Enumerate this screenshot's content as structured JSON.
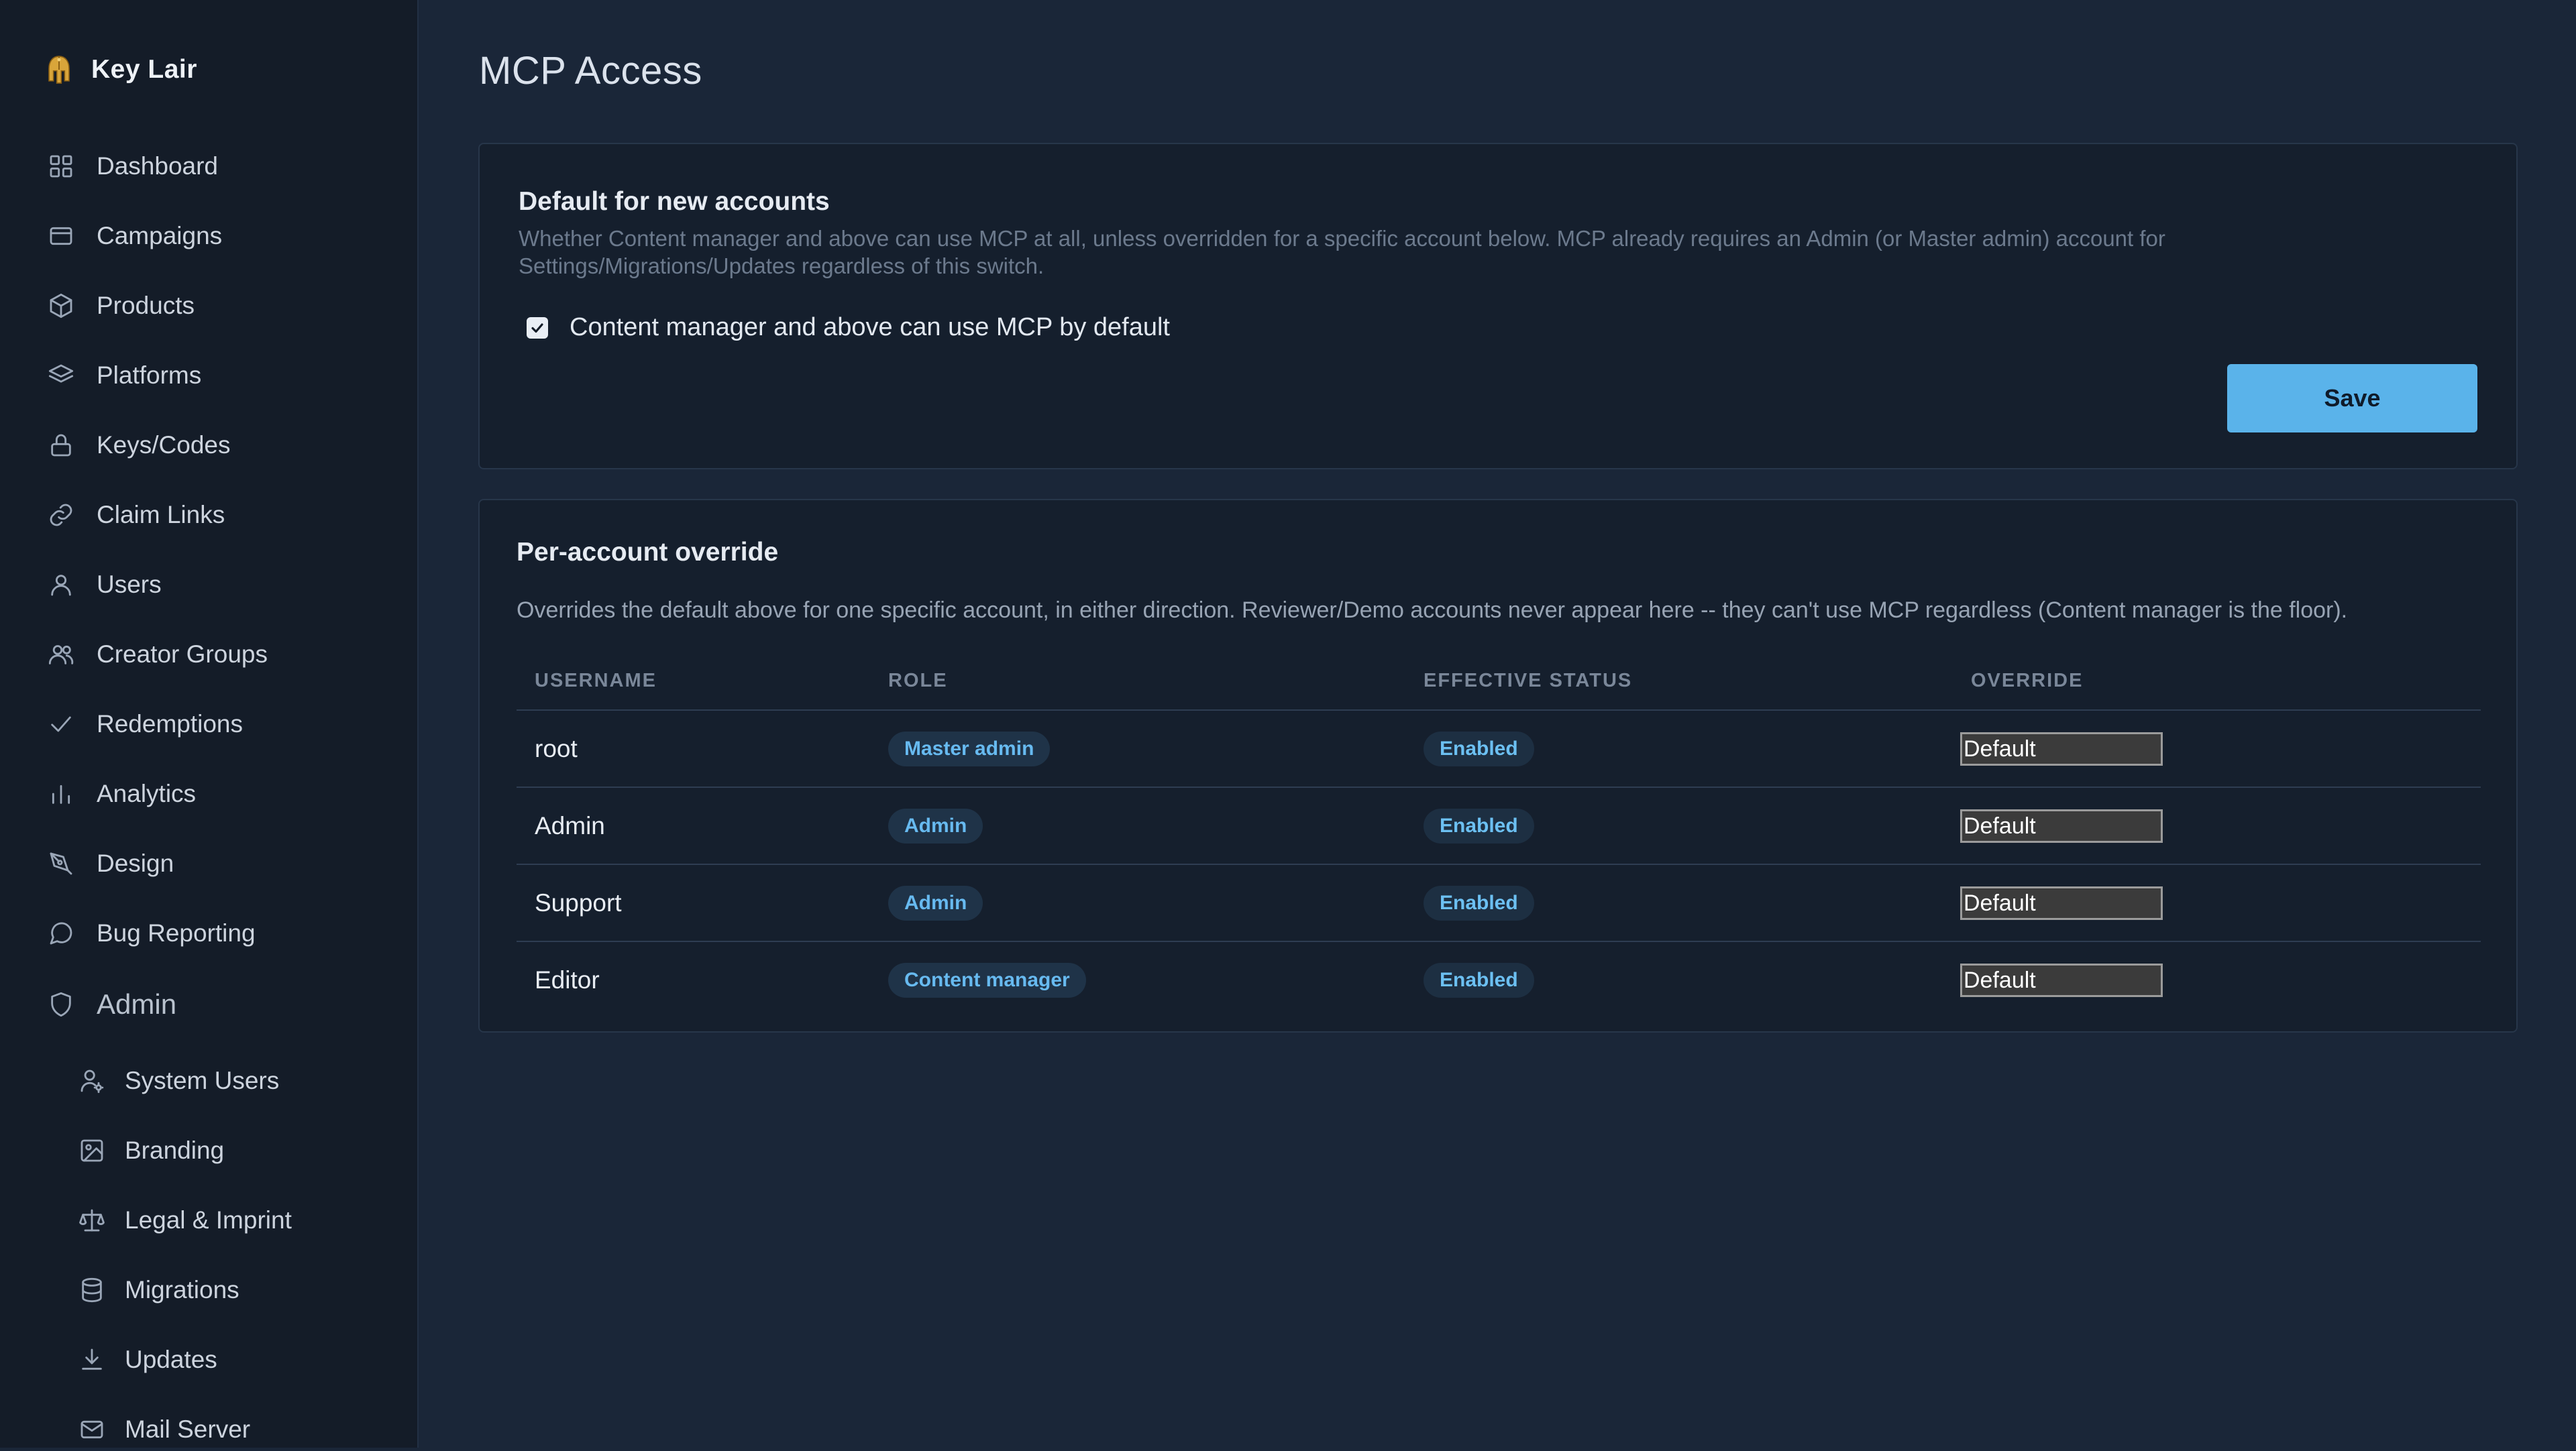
{
  "brand": {
    "name": "Key Lair",
    "logo_icon": "helmet-logo-icon"
  },
  "sidebar": {
    "items": [
      {
        "label": "Dashboard",
        "icon": "grid-icon"
      },
      {
        "label": "Campaigns",
        "icon": "card-icon"
      },
      {
        "label": "Products",
        "icon": "box-icon"
      },
      {
        "label": "Platforms",
        "icon": "layers-icon"
      },
      {
        "label": "Keys/Codes",
        "icon": "lock-icon"
      },
      {
        "label": "Claim Links",
        "icon": "link-icon"
      },
      {
        "label": "Users",
        "icon": "user-icon"
      },
      {
        "label": "Creator Groups",
        "icon": "users-icon"
      },
      {
        "label": "Redemptions",
        "icon": "check-icon"
      },
      {
        "label": "Analytics",
        "icon": "bar-chart-icon"
      },
      {
        "label": "Design",
        "icon": "pen-tool-icon"
      },
      {
        "label": "Bug Reporting",
        "icon": "message-icon"
      },
      {
        "label": "Admin",
        "icon": "shield-icon"
      }
    ],
    "admin_items": [
      {
        "label": "System Users",
        "icon": "user-cog-icon"
      },
      {
        "label": "Branding",
        "icon": "image-icon"
      },
      {
        "label": "Legal & Imprint",
        "icon": "scale-icon"
      },
      {
        "label": "Migrations",
        "icon": "database-icon"
      },
      {
        "label": "Updates",
        "icon": "download-icon"
      },
      {
        "label": "Mail Server",
        "icon": "mail-icon"
      }
    ]
  },
  "page": {
    "title": "MCP Access"
  },
  "default_section": {
    "title": "Default for new accounts",
    "description_line1": "Whether Content manager and above can use MCP at all, unless overridden for a specific account below. MCP already requires an Admin (or Master admin) account for",
    "description_line2": "Settings/Migrations/Updates regardless of this switch.",
    "checkbox_label": "Content manager and above can use MCP by default",
    "checkbox_checked": true,
    "save_label": "Save"
  },
  "override_section": {
    "title": "Per-account override",
    "description": "Overrides the default above for one specific account, in either direction. Reviewer/Demo accounts never appear here -- they can't use MCP regardless (Content manager is the floor).",
    "columns": [
      "USERNAME",
      "ROLE",
      "EFFECTIVE STATUS",
      "OVERRIDE"
    ],
    "rows": [
      {
        "username": "root",
        "role": "Master admin",
        "status": "Enabled",
        "override": "Default"
      },
      {
        "username": "Admin",
        "role": "Admin",
        "status": "Enabled",
        "override": "Default"
      },
      {
        "username": "Support",
        "role": "Admin",
        "status": "Enabled",
        "override": "Default"
      },
      {
        "username": "Editor",
        "role": "Content manager",
        "status": "Enabled",
        "override": "Default"
      }
    ]
  },
  "colors": {
    "background": "#1a2638",
    "sidebar": "#141c28",
    "card": "#151f2d",
    "accent": "#5ab3ea",
    "badge_text": "#67baf0"
  }
}
